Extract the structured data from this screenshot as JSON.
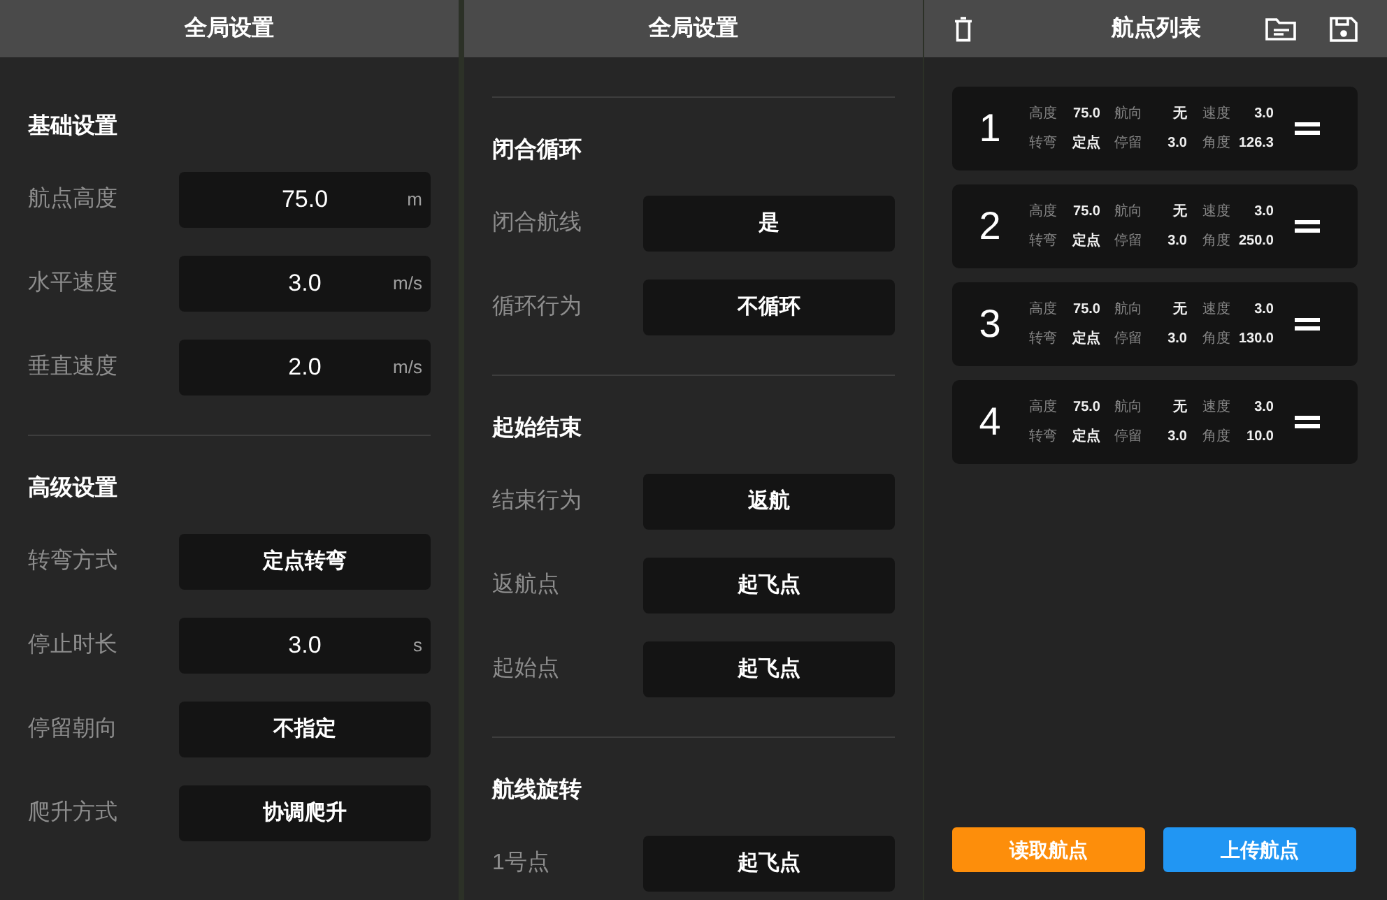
{
  "panels": [
    {
      "title": "全局设置",
      "top_rule": false,
      "sections": [
        {
          "title": "基础设置",
          "rows": [
            {
              "kind": "input",
              "label": "航点高度",
              "value": "75.0",
              "unit": "m"
            },
            {
              "kind": "input",
              "label": "水平速度",
              "value": "3.0",
              "unit": "m/s"
            },
            {
              "kind": "input",
              "label": "垂直速度",
              "value": "2.0",
              "unit": "m/s"
            }
          ]
        },
        {
          "title": "高级设置",
          "rows": [
            {
              "kind": "select",
              "label": "转弯方式",
              "value": "定点转弯"
            },
            {
              "kind": "input",
              "label": "停止时长",
              "value": "3.0",
              "unit": "s"
            },
            {
              "kind": "select",
              "label": "停留朝向",
              "value": "不指定"
            },
            {
              "kind": "select",
              "label": "爬升方式",
              "value": "协调爬升"
            }
          ]
        }
      ]
    },
    {
      "title": "全局设置",
      "top_rule": true,
      "sections": [
        {
          "title": "闭合循环",
          "rows": [
            {
              "kind": "select",
              "label": "闭合航线",
              "value": "是"
            },
            {
              "kind": "select",
              "label": "循环行为",
              "value": "不循环"
            }
          ]
        },
        {
          "title": "起始结束",
          "rows": [
            {
              "kind": "select",
              "label": "结束行为",
              "value": "返航"
            },
            {
              "kind": "select",
              "label": "返航点",
              "value": "起飞点"
            },
            {
              "kind": "select",
              "label": "起始点",
              "value": "起飞点"
            }
          ]
        },
        {
          "title": "航线旋转",
          "rows": [
            {
              "kind": "select",
              "label": "1号点",
              "value": "起飞点"
            }
          ]
        }
      ]
    }
  ],
  "waypoint_list": {
    "title": "航点列表",
    "waypoints": [
      {
        "number": "1",
        "fields": [
          {
            "label": "高度",
            "value": "75.0"
          },
          {
            "label": "航向",
            "value": "无"
          },
          {
            "label": "速度",
            "value": "3.0"
          },
          {
            "label": "转弯",
            "value": "定点"
          },
          {
            "label": "停留",
            "value": "3.0"
          },
          {
            "label": "角度",
            "value": "126.3"
          }
        ]
      },
      {
        "number": "2",
        "fields": [
          {
            "label": "高度",
            "value": "75.0"
          },
          {
            "label": "航向",
            "value": "无"
          },
          {
            "label": "速度",
            "value": "3.0"
          },
          {
            "label": "转弯",
            "value": "定点"
          },
          {
            "label": "停留",
            "value": "3.0"
          },
          {
            "label": "角度",
            "value": "250.0"
          }
        ]
      },
      {
        "number": "3",
        "fields": [
          {
            "label": "高度",
            "value": "75.0"
          },
          {
            "label": "航向",
            "value": "无"
          },
          {
            "label": "速度",
            "value": "3.0"
          },
          {
            "label": "转弯",
            "value": "定点"
          },
          {
            "label": "停留",
            "value": "3.0"
          },
          {
            "label": "角度",
            "value": "130.0"
          }
        ]
      },
      {
        "number": "4",
        "fields": [
          {
            "label": "高度",
            "value": "75.0"
          },
          {
            "label": "航向",
            "value": "无"
          },
          {
            "label": "速度",
            "value": "3.0"
          },
          {
            "label": "转弯",
            "value": "定点"
          },
          {
            "label": "停留",
            "value": "3.0"
          },
          {
            "label": "角度",
            "value": "10.0"
          }
        ]
      }
    ],
    "buttons": [
      {
        "kind": "read",
        "label": "读取航点"
      },
      {
        "kind": "upload",
        "label": "上传航点"
      }
    ]
  }
}
